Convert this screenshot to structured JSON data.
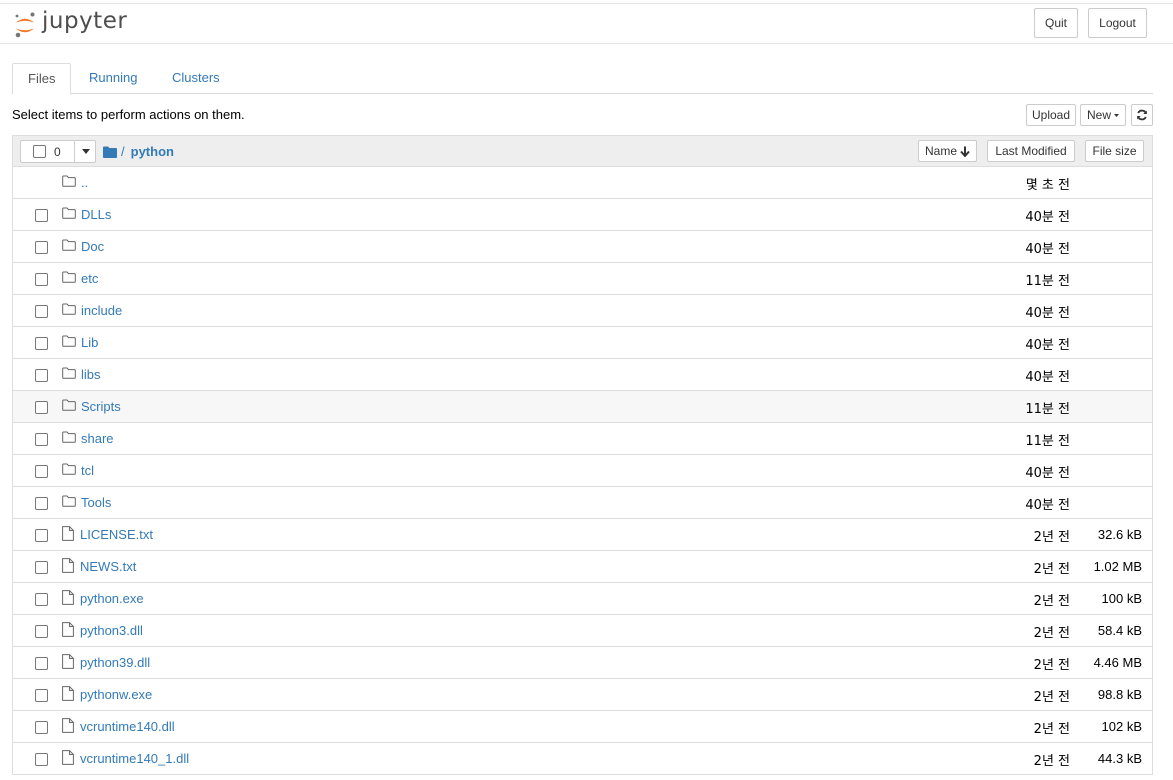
{
  "app": {
    "logo_text": "jupyter",
    "quit_label": "Quit",
    "logout_label": "Logout"
  },
  "tabs": [
    {
      "label": "Files",
      "active": true
    },
    {
      "label": "Running",
      "active": false
    },
    {
      "label": "Clusters",
      "active": false
    }
  ],
  "toolbar": {
    "hint": "Select items to perform actions on them.",
    "upload_label": "Upload",
    "new_label": "New",
    "refresh_icon": "refresh-icon"
  },
  "list_header": {
    "selected_count": "0",
    "breadcrumb_sep": "/",
    "current_dir": "python",
    "sort_name_label": "Name",
    "sort_modified_label": "Last Modified",
    "sort_size_label": "File size"
  },
  "rows": [
    {
      "name": "..",
      "type": "folder",
      "modified": "몇 초 전",
      "size": "",
      "parent": true
    },
    {
      "name": "DLLs",
      "type": "folder",
      "modified": "40분 전",
      "size": ""
    },
    {
      "name": "Doc",
      "type": "folder",
      "modified": "40분 전",
      "size": ""
    },
    {
      "name": "etc",
      "type": "folder",
      "modified": "11분 전",
      "size": ""
    },
    {
      "name": "include",
      "type": "folder",
      "modified": "40분 전",
      "size": ""
    },
    {
      "name": "Lib",
      "type": "folder",
      "modified": "40분 전",
      "size": ""
    },
    {
      "name": "libs",
      "type": "folder",
      "modified": "40분 전",
      "size": ""
    },
    {
      "name": "Scripts",
      "type": "folder",
      "modified": "11분 전",
      "size": "",
      "hover": true
    },
    {
      "name": "share",
      "type": "folder",
      "modified": "11분 전",
      "size": ""
    },
    {
      "name": "tcl",
      "type": "folder",
      "modified": "40분 전",
      "size": ""
    },
    {
      "name": "Tools",
      "type": "folder",
      "modified": "40분 전",
      "size": ""
    },
    {
      "name": "LICENSE.txt",
      "type": "file",
      "modified": "2년 전",
      "size": "32.6 kB"
    },
    {
      "name": "NEWS.txt",
      "type": "file",
      "modified": "2년 전",
      "size": "1.02 MB"
    },
    {
      "name": "python.exe",
      "type": "file",
      "modified": "2년 전",
      "size": "100 kB"
    },
    {
      "name": "python3.dll",
      "type": "file",
      "modified": "2년 전",
      "size": "58.4 kB"
    },
    {
      "name": "python39.dll",
      "type": "file",
      "modified": "2년 전",
      "size": "4.46 MB"
    },
    {
      "name": "pythonw.exe",
      "type": "file",
      "modified": "2년 전",
      "size": "98.8 kB"
    },
    {
      "name": "vcruntime140.dll",
      "type": "file",
      "modified": "2년 전",
      "size": "102 kB"
    },
    {
      "name": "vcruntime140_1.dll",
      "type": "file",
      "modified": "2년 전",
      "size": "44.3 kB"
    }
  ],
  "colors": {
    "link": "#337ab7",
    "logo_orange": "#f37726",
    "logo_gray": "#767677"
  }
}
